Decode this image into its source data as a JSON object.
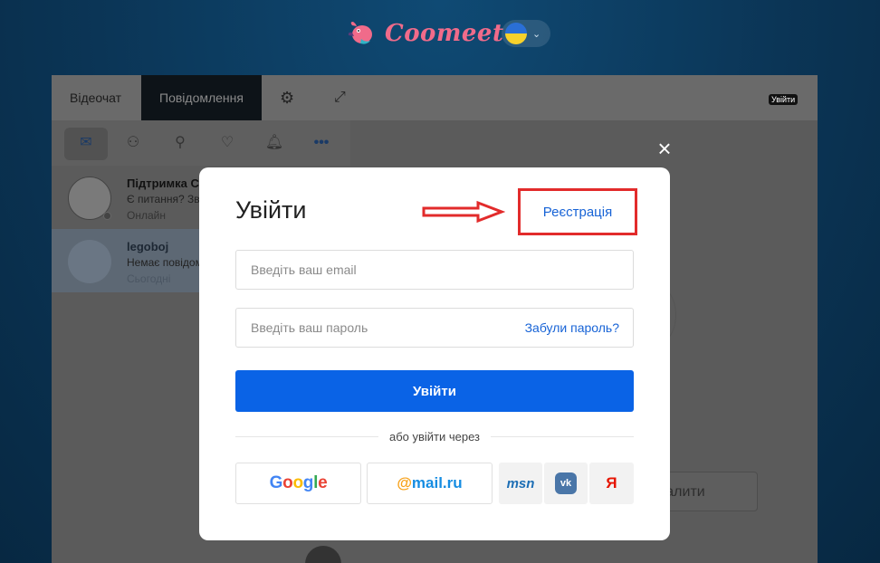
{
  "header": {
    "logo_text": "Coomeet",
    "language": "Ukrainian",
    "lang_chevron": "⌄"
  },
  "app": {
    "tabs": [
      {
        "label": "Відеочат"
      },
      {
        "label": "Повідомлення"
      }
    ],
    "user_badge": "Увійти",
    "contacts": [
      {
        "name": "Підтримка С",
        "message": "Є питання? Зв",
        "status": "Онлайн"
      },
      {
        "name": "legoboj",
        "message": "Немає повідом",
        "status": "Сьогодні"
      }
    ],
    "delete_button": "алити"
  },
  "modal": {
    "close": "×",
    "title": "Увійти",
    "register_label": "Реєстрація",
    "email_placeholder": "Введіть ваш email",
    "password_placeholder": "Введіть ваш пароль",
    "forgot_label": "Забули пароль?",
    "login_label": "Увійти",
    "divider_text": "або увійти через",
    "social": {
      "google": "Google",
      "mail_at": "@",
      "mail_text": "mail.ru",
      "msn": "msn",
      "vk": "vk",
      "yandex": "Я"
    }
  },
  "colors": {
    "accent": "#0a63e6",
    "link": "#1763d6",
    "highlight_box": "#e22b2b",
    "logo": "#f06b8a"
  }
}
